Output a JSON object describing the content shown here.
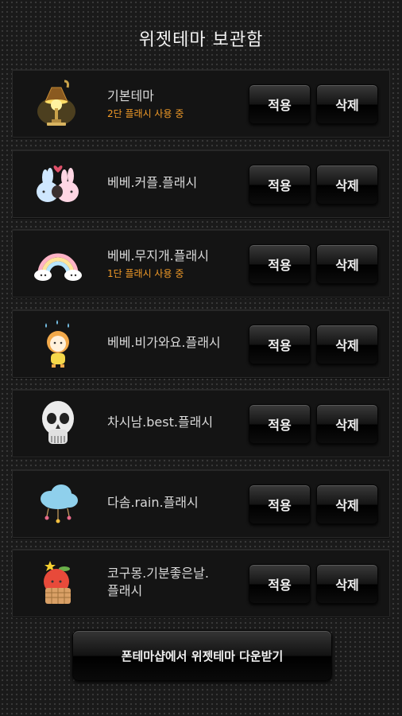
{
  "header": {
    "title": "위젯테마 보관함"
  },
  "themes": [
    {
      "icon": "lamp-icon",
      "name": "기본테마",
      "status": "2단 플래시 사용 중",
      "apply_label": "적용",
      "delete_label": "삭제"
    },
    {
      "icon": "bunny-couple-icon",
      "name": "베베.커플.플래시",
      "status": "",
      "apply_label": "적용",
      "delete_label": "삭제"
    },
    {
      "icon": "rainbow-icon",
      "name": "베베.무지개.플래시",
      "status": "1단 플래시 사용 중",
      "apply_label": "적용",
      "delete_label": "삭제"
    },
    {
      "icon": "rain-character-icon",
      "name": "베베.비가와요.플래시",
      "status": "",
      "apply_label": "적용",
      "delete_label": "삭제"
    },
    {
      "icon": "skull-icon",
      "name": "차시남.best.플래시",
      "status": "",
      "apply_label": "적용",
      "delete_label": "삭제"
    },
    {
      "icon": "rain-cloud-icon",
      "name": "다솜.rain.플래시",
      "status": "",
      "apply_label": "적용",
      "delete_label": "삭제"
    },
    {
      "icon": "apple-character-icon",
      "name": "코구몽.기분좋은날.\n플래시",
      "status": "",
      "apply_label": "적용",
      "delete_label": "삭제"
    }
  ],
  "footer": {
    "download_label": "폰테마샵에서 위젯테마 다운받기"
  },
  "colors": {
    "status_orange": "#f09a28",
    "background": "#1a1a1a"
  }
}
